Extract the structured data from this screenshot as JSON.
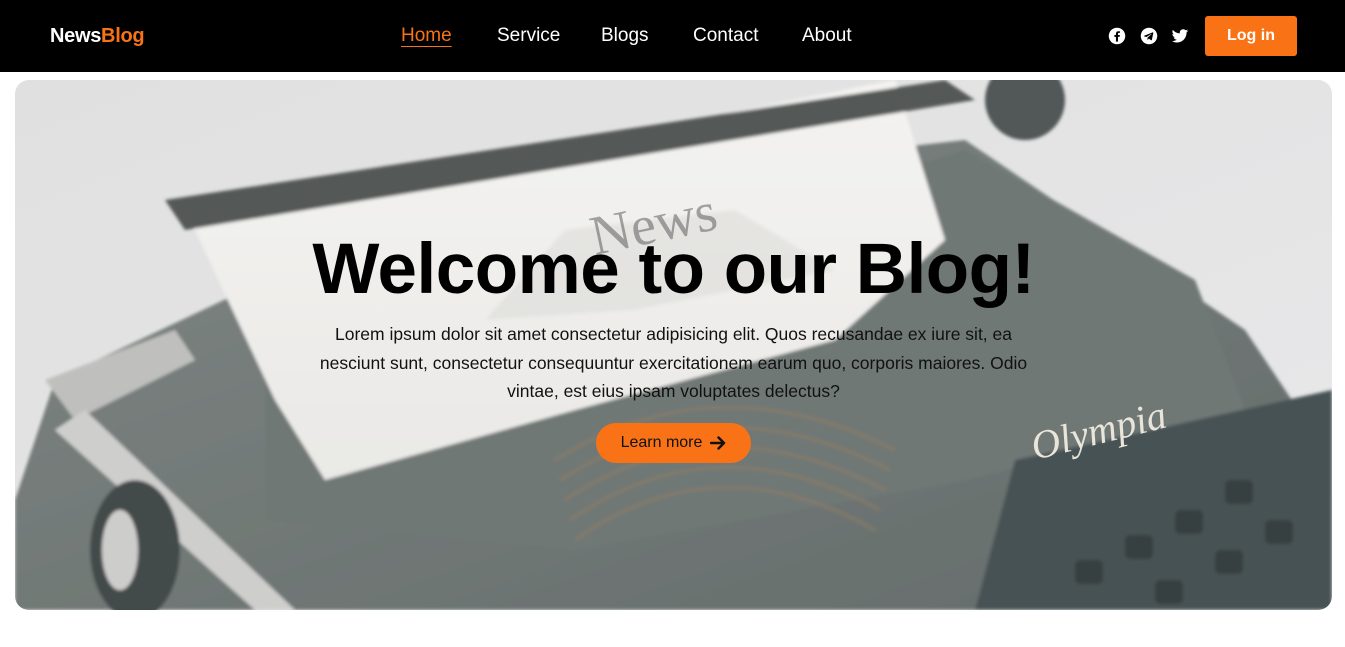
{
  "header": {
    "logo": {
      "part1": "News",
      "part2": "Blog"
    },
    "nav": [
      {
        "label": "Home",
        "active": true
      },
      {
        "label": "Service",
        "active": false
      },
      {
        "label": "Blogs",
        "active": false
      },
      {
        "label": "Contact",
        "active": false
      },
      {
        "label": "About",
        "active": false
      }
    ],
    "social_icons": [
      "facebook-icon",
      "telegram-icon",
      "twitter-icon"
    ],
    "login_label": "Log in"
  },
  "hero": {
    "title": "Welcome to our Blog!",
    "description": "Lorem ipsum dolor sit amet consectetur adipisicing elit. Quos recusandae ex iure sit, ea nesciunt sunt, consectetur consequuntur exercitationem earum quo, corporis maiores. Odio vintae, est eius ipsam voluptates delectus?",
    "button_label": "Learn more",
    "button_icon": "arrow-right-icon",
    "background_image": "typewriter-photo",
    "paper_text": "News",
    "brand_text": "Olympia"
  },
  "colors": {
    "accent": "#f97316",
    "navbar_bg": "#000000",
    "page_bg": "#ffffff"
  }
}
